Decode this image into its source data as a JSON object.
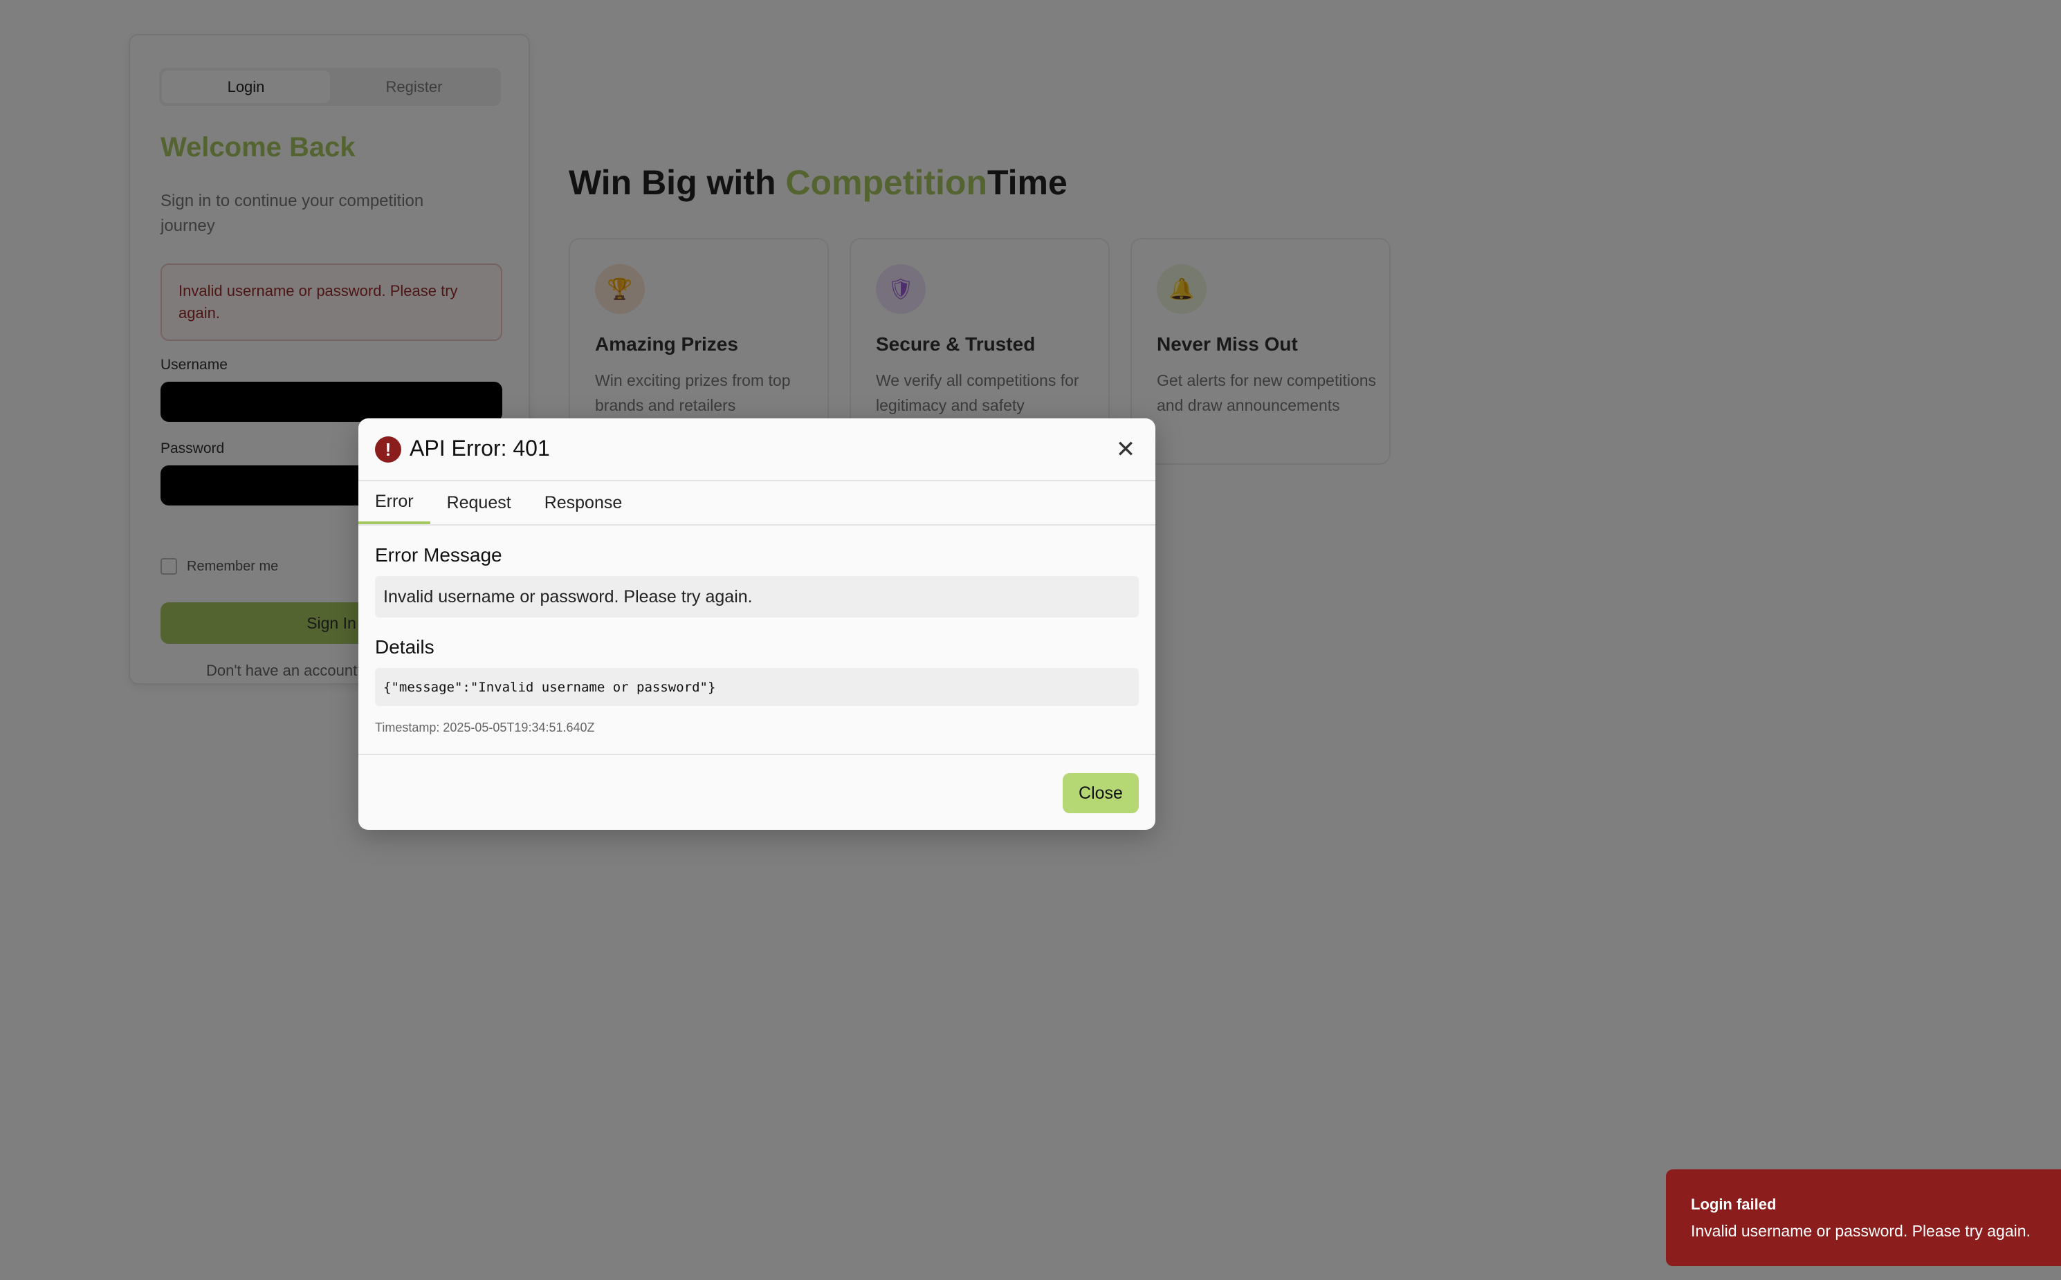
{
  "auth": {
    "tabs": [
      "Login",
      "Register"
    ],
    "welcome_title": "Welcome Back",
    "welcome_subtitle": "Sign in to continue your competition journey",
    "inline_error": "Invalid username or password. Please try again.",
    "username_label": "Username",
    "password_label": "Password",
    "remember_label": "Remember me",
    "signin_label": "Sign In",
    "signup_prompt": "Don't have an account?"
  },
  "hero": {
    "title_prefix": "Win Big with ",
    "title_accent": "Competition",
    "title_suffix": "Time",
    "features": [
      {
        "icon": "trophy-icon",
        "glyph": "🏆",
        "title": "Amazing Prizes",
        "description": "Win exciting prizes from top brands and retailers"
      },
      {
        "icon": "shield-icon",
        "glyph": "🛡",
        "title": "Secure & Trusted",
        "description": "We verify all competitions for legitimacy and safety"
      },
      {
        "icon": "bell-icon",
        "glyph": "🔔",
        "title": "Never Miss Out",
        "description": "Get alerts for new competitions and draw announcements"
      }
    ]
  },
  "modal": {
    "title": "API Error: 401",
    "close_glyph": "✕",
    "tabs": [
      "Error",
      "Request",
      "Response"
    ],
    "error_message_heading": "Error Message",
    "error_message": "Invalid username or password. Please try again.",
    "details_heading": "Details",
    "details": "{\"message\":\"Invalid username or password\"}",
    "timestamp": "Timestamp: 2025-05-05T19:34:51.640Z",
    "close_label": "Close"
  },
  "toast": {
    "title": "Login failed",
    "message": "Invalid username or password. Please try again."
  },
  "colors": {
    "accent": "#a6c861",
    "error": "#8b1d1d",
    "overlay": "rgba(0,0,0,0.5)"
  }
}
